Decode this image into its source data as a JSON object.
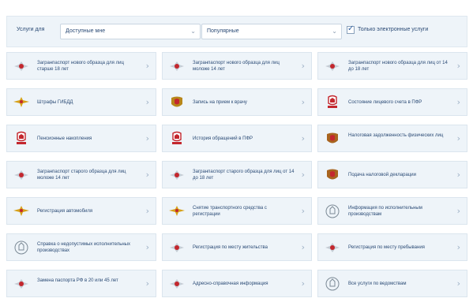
{
  "filters": {
    "label": "Услуги для",
    "audience": "Доступные мне",
    "sort": "Популярные",
    "electronic_only": "Только электронные услуги",
    "electronic_only_checked": true
  },
  "tiles": [
    {
      "text": "Загранпаспорт нового образца для лиц старше 18 лет",
      "icon": "eagle-emblem-icon",
      "color": "#c3272e"
    },
    {
      "text": "Загранпаспорт нового образца для лиц моложе 14 лет",
      "icon": "eagle-emblem-icon",
      "color": "#c3272e"
    },
    {
      "text": "Загранпаспорт нового образца для лиц от 14 до 18 лет",
      "icon": "eagle-emblem-icon",
      "color": "#c3272e"
    },
    {
      "text": "Штрафы ГИБДД",
      "icon": "gibdd-emblem-icon",
      "color": "#d6a21a"
    },
    {
      "text": "Запись на прием к врачу",
      "icon": "health-emblem-icon",
      "color": "#b8861a"
    },
    {
      "text": "Состояние лицевого счета в ПФР",
      "icon": "pfr-emblem-icon",
      "color": "#c3272e"
    },
    {
      "text": "Пенсионные накопления",
      "icon": "pfr-emblem-icon",
      "color": "#c3272e"
    },
    {
      "text": "История обращений в ПФР",
      "icon": "pfr-emblem-icon",
      "color": "#c3272e"
    },
    {
      "text": "Налоговая задолженность физических лиц",
      "icon": "tax-emblem-icon",
      "color": "#a8641f"
    },
    {
      "text": "Загранпаспорт старого образца для лиц моложе 14 лет",
      "icon": "eagle-emblem-icon",
      "color": "#c3272e"
    },
    {
      "text": "Загранпаспорт старого образца для лиц от 14 до 18 лет",
      "icon": "eagle-emblem-icon",
      "color": "#c3272e"
    },
    {
      "text": "Подача налоговой декларации",
      "icon": "tax-emblem-icon",
      "color": "#a8641f"
    },
    {
      "text": "Регистрация автомобиля",
      "icon": "gibdd-emblem-icon",
      "color": "#d6a21a"
    },
    {
      "text": "Снятие транспортного средства с регистрации",
      "icon": "gibdd-emblem-icon",
      "color": "#d6a21a"
    },
    {
      "text": "Информация по исполнительным производствам",
      "icon": "bailiff-emblem-icon",
      "color": "#7c8a96"
    },
    {
      "text": "Справка о недопустимых исполнительных производствах",
      "icon": "bailiff-emblem-icon",
      "color": "#7c8a96"
    },
    {
      "text": "Регистрация по месту жительства",
      "icon": "eagle-emblem-icon",
      "color": "#c3272e"
    },
    {
      "text": "Регистрация по месту пребывания",
      "icon": "eagle-emblem-icon",
      "color": "#c3272e"
    },
    {
      "text": "Замена паспорта РФ в 20 или 45 лет",
      "icon": "eagle-emblem-icon",
      "color": "#c3272e"
    },
    {
      "text": "Адресно-справочная информация",
      "icon": "eagle-emblem-icon",
      "color": "#c3272e"
    },
    {
      "text": "Все услуги по ведомствам",
      "icon": "bailiff-emblem-icon",
      "color": "#7c8a96"
    }
  ]
}
